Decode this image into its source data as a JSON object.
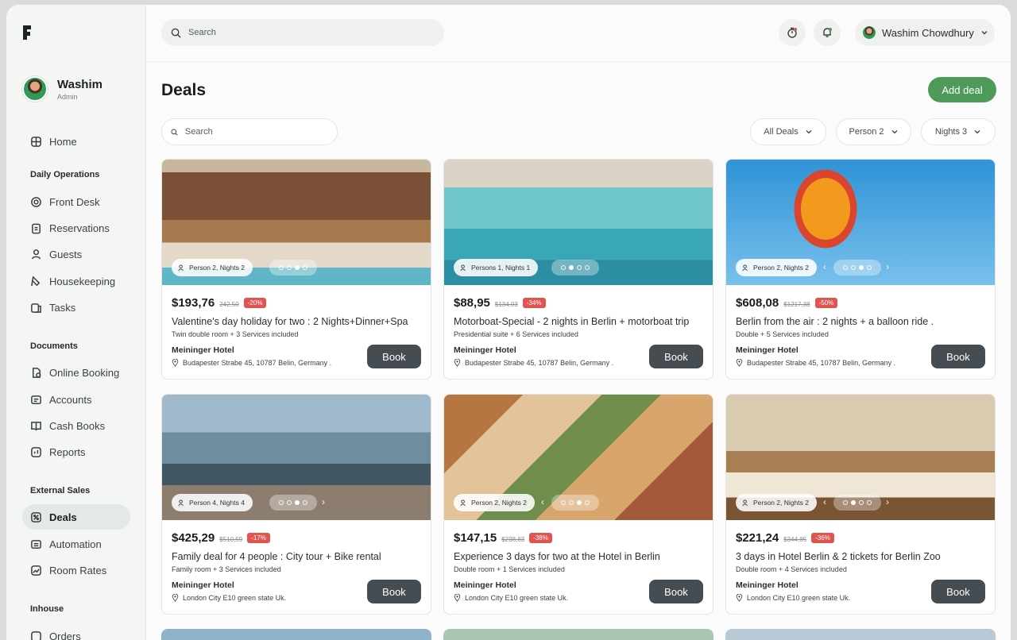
{
  "profile": {
    "name": "Washim",
    "role": "Admin"
  },
  "sidebar": {
    "home": "Home",
    "sections": [
      {
        "title": "Daily Operations",
        "items": [
          "Front Desk",
          "Reservations",
          "Guests",
          "Housekeeping",
          "Tasks"
        ]
      },
      {
        "title": "Documents",
        "items": [
          "Online Booking",
          "Accounts",
          "Cash Books",
          "Reports"
        ]
      },
      {
        "title": "External Sales",
        "items": [
          "Deals",
          "Automation",
          "Room Rates"
        ]
      },
      {
        "title": "Inhouse",
        "items": [
          "Orders"
        ]
      }
    ],
    "active": "Deals"
  },
  "topbar": {
    "search_placeholder": "Search",
    "user_name": "Washim Chowdhury"
  },
  "page": {
    "title": "Deals",
    "add_button": "Add deal",
    "search_placeholder": "Search",
    "filters": [
      "All Deals",
      "Person 2",
      "Nights 3"
    ]
  },
  "book_label": "Book",
  "deals": [
    {
      "badge": "Person 2, Nights 2",
      "price": "$193,76",
      "old_price": "242,50",
      "discount": "-20%",
      "title": "Valentine's day holiday for two : 2 Nights+Dinner+Spa",
      "sub": "Twin double room + 3 Services included",
      "hotel": "Meininger Hotel",
      "address": "Budapester Strabe 45, 10787 Belin, Germany ."
    },
    {
      "badge": "Persons 1, Nights 1",
      "price": "$88,95",
      "old_price": "$134,03",
      "discount": "-34%",
      "title": "Motorboat-Special - 2 nights in Berlin + motorboat trip",
      "sub": "Presidential suite + 6 Services included",
      "hotel": "Meininger Hotel",
      "address": "Budapester Strabe 45, 10787 Belin, Germany ."
    },
    {
      "badge": "Person 2, Nights 2",
      "price": "$608,08",
      "old_price": "$1217,38",
      "discount": "-50%",
      "title": "Berlin from the air : 2 nights + a balloon ride .",
      "sub": "Double + 5 Services included",
      "hotel": "Meininger Hotel",
      "address": "Budapester Strabe 45, 10787 Belin, Germany ."
    },
    {
      "badge": "Person 4, Nights 4",
      "price": "$425,29",
      "old_price": "$510,59",
      "discount": "-17%",
      "title": "Family deal for 4 people : City tour + Bike rental",
      "sub": "Family room + 3 Services included",
      "hotel": "Meininger Hotel",
      "address": "London City E10 green state Uk."
    },
    {
      "badge": "Person 2, Nights 2",
      "price": "$147,15",
      "old_price": "$238,83",
      "discount": "-38%",
      "title": "Experience 3 days for two at the Hotel in Berlin",
      "sub": "Double room + 1 Services included",
      "hotel": "Meininger Hotel",
      "address": "London City E10 green state Uk."
    },
    {
      "badge": "Person 2, Nights 2",
      "price": "$221,24",
      "old_price": "$344,85",
      "discount": "-36%",
      "title": "3 days in Hotel Berlin & 2 tickets for Berlin Zoo",
      "sub": "Double room + 4 Services included",
      "hotel": "Meininger Hotel",
      "address": "London City E10 green state Uk."
    }
  ]
}
